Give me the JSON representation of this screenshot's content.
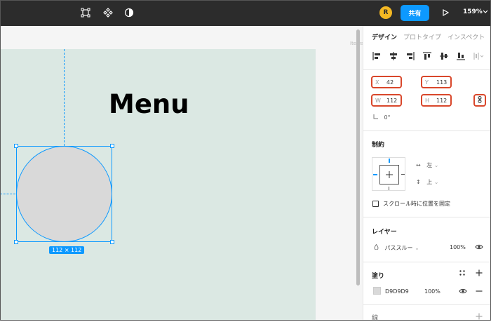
{
  "topbar": {
    "avatar_initial": "R",
    "share_label": "共有",
    "zoom_label": "159%"
  },
  "canvas": {
    "frame_title": "Menu",
    "size_badge": "112 × 112",
    "items_label": "Items"
  },
  "panel": {
    "tabs": [
      {
        "label": "デザイン",
        "active": true
      },
      {
        "label": "プロトタイプ",
        "active": false
      },
      {
        "label": "インスペクト",
        "active": false
      }
    ],
    "position": {
      "x_label": "X",
      "x_value": "42",
      "y_label": "Y",
      "y_value": "113"
    },
    "size": {
      "w_label": "W",
      "w_value": "112",
      "h_label": "H",
      "h_value": "112"
    },
    "rotation": "0°",
    "constraints": {
      "title": "制約",
      "horizontal": "左",
      "vertical": "上",
      "fix_position_label": "スクロール時に位置を固定"
    },
    "layer": {
      "title": "レイヤー",
      "blend_mode": "パススルー",
      "opacity": "100%"
    },
    "fill": {
      "title": "塗り",
      "color_hex": "D9D9D9",
      "opacity": "100%"
    },
    "stroke": {
      "title": "線"
    }
  },
  "colors": {
    "accent": "#0d99ff",
    "highlight": "#d9472b",
    "frame_bg": "#dbe8e3",
    "shape_fill": "#d9d9d9"
  }
}
